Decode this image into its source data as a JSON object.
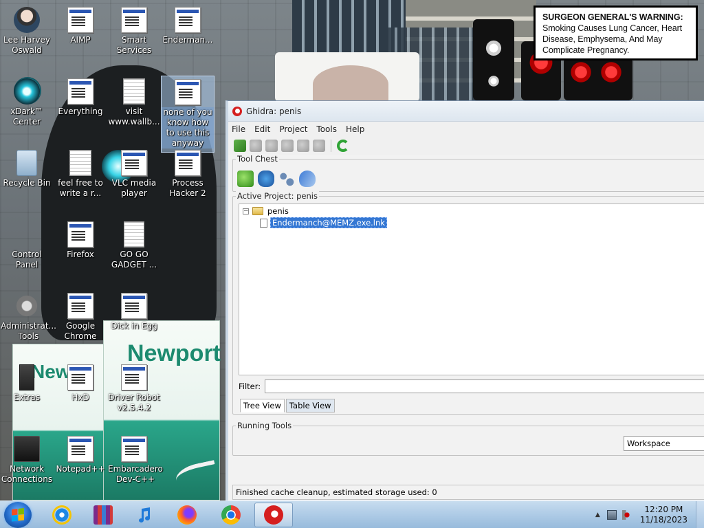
{
  "warning": {
    "heading": "SURGEON GENERAL'S WARNING:",
    "body": "Smoking Causes Lung Cancer, Heart Disease, Emphysema, And May Complicate Pregnancy."
  },
  "wallpaper": {
    "pack_label_1": "Newport",
    "pack_label_2": "Newp"
  },
  "desktop_icons": [
    {
      "label": "Lee Harvey Oswald"
    },
    {
      "label": "AIMP"
    },
    {
      "label": "Smart Services"
    },
    {
      "label": "Enderman..."
    },
    {
      "label": "xDark™ Center"
    },
    {
      "label": "Everything"
    },
    {
      "label": "visit www.wallb..."
    },
    {
      "label": "none of you know how to use this anyway"
    },
    {
      "label": "Recycle Bin"
    },
    {
      "label": "feel free to write a r..."
    },
    {
      "label": "VLC media player"
    },
    {
      "label": "Process Hacker 2"
    },
    {
      "label": "Control Panel"
    },
    {
      "label": "Firefox"
    },
    {
      "label": "GO GO GADGET ..."
    },
    {
      "label": "Administrat... Tools"
    },
    {
      "label": "Google Chrome"
    },
    {
      "label": "Dick in Egg"
    },
    {
      "label": "Extras"
    },
    {
      "label": "HxD"
    },
    {
      "label": "Driver Robot v2.5.4.2"
    },
    {
      "label": "Network Connections"
    },
    {
      "label": "Notepad++"
    },
    {
      "label": "Embarcadero Dev-C++"
    }
  ],
  "ghidra": {
    "title": "Ghidra: penis",
    "menu": [
      "File",
      "Edit",
      "Project",
      "Tools",
      "Help"
    ],
    "tool_chest_label": "Tool Chest",
    "active_project_label": "Active Project: penis",
    "tree": {
      "root": "penis",
      "expander": "−",
      "child": "Endermanch@MEMZ.exe.lnk"
    },
    "filter_label": "Filter:",
    "filter_value": "",
    "tabs": [
      "Tree View",
      "Table View"
    ],
    "running_tools_label": "Running Tools",
    "workspace": "Workspace",
    "status": "Finished cache cleanup, estimated storage used: 0"
  },
  "taskbar": {
    "pinned": [
      "Internet Explorer",
      "WinRAR",
      "iTunes",
      "Firefox",
      "Chrome",
      "Ghidra"
    ],
    "clock_time": "12:20 PM",
    "clock_date": "11/18/2023",
    "tray_arrow": "▲"
  },
  "colors": {
    "taskbar": "#aecbe6",
    "selection": "#3477d3",
    "ghidra_red": "#d51f1f"
  }
}
